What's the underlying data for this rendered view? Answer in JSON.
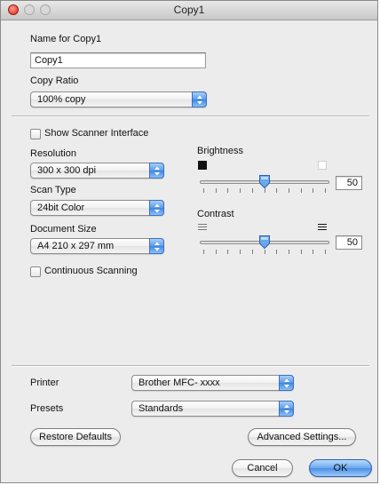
{
  "window": {
    "title": "Copy1"
  },
  "name_section": {
    "name_label": "Name for Copy1",
    "name_value": "Copy1",
    "ratio_label": "Copy Ratio",
    "ratio_value": "100% copy"
  },
  "scanner": {
    "show_interface_label": "Show Scanner Interface",
    "show_interface_checked": false,
    "resolution_label": "Resolution",
    "resolution_value": "300 x 300 dpi",
    "scan_type_label": "Scan Type",
    "scan_type_value": "24bit Color",
    "doc_size_label": "Document Size",
    "doc_size_value": "A4 210 x 297 mm",
    "continuous_label": "Continuous Scanning",
    "continuous_checked": false
  },
  "adjust": {
    "brightness_label": "Brightness",
    "brightness_value": "50",
    "contrast_label": "Contrast",
    "contrast_value": "50",
    "range": [
      0,
      100
    ]
  },
  "printer_section": {
    "printer_label": "Printer",
    "printer_value": "Brother MFC- xxxx",
    "presets_label": "Presets",
    "presets_value": "Standards"
  },
  "buttons": {
    "restore_defaults": "Restore Defaults",
    "advanced_settings": "Advanced Settings...",
    "cancel": "Cancel",
    "ok": "OK"
  },
  "colors": {
    "accent": "#4a8fe6",
    "window_bg": "#ececec",
    "close_button": "#d42a1a"
  }
}
